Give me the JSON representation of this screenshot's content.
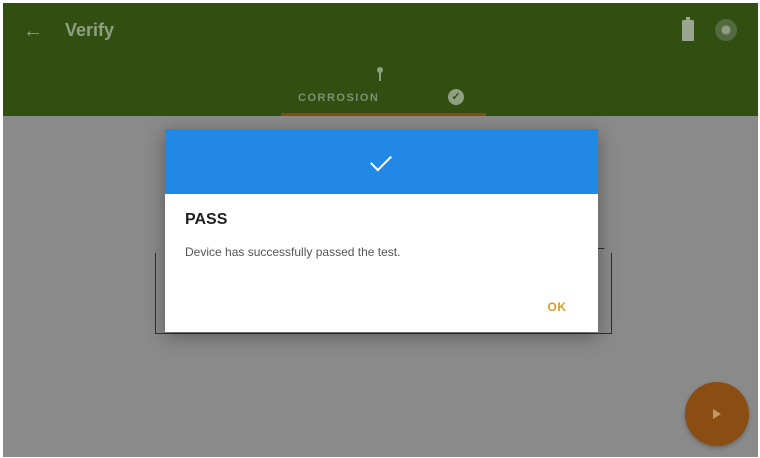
{
  "appbar": {
    "title": "Verify",
    "back_icon": "arrow-left-icon",
    "battery_icon": "battery-icon",
    "status_icon": "status-dot-icon",
    "color": "#314f11"
  },
  "tabs": [
    {
      "label": "CORROSION",
      "icon": "key-icon",
      "status_icon": "check-circle-icon",
      "selected": true
    }
  ],
  "dialog": {
    "header_icon": "check-icon",
    "header_color": "#2188e6",
    "title": "PASS",
    "message": "Device has successfully passed the test.",
    "ok_label": "OK",
    "ok_color": "#e49a1a"
  },
  "fab": {
    "icon": "play-icon",
    "color": "#e88a1e"
  }
}
